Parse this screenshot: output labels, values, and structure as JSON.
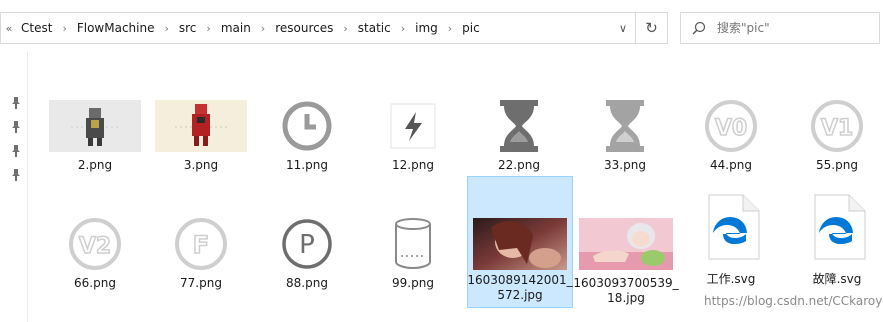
{
  "address_bar": {
    "prefix": "«",
    "crumbs": [
      "Ctest",
      "FlowMachine",
      "src",
      "main",
      "resources",
      "static",
      "img",
      "pic"
    ],
    "separator": "›",
    "dropdown": "∨"
  },
  "refresh_glyph": "↻",
  "search": {
    "placeholder": "搜索\"pic\""
  },
  "files": [
    {
      "name": "2.png",
      "icon": "robot-thumbnail-icon"
    },
    {
      "name": "3.png",
      "icon": "robot-red-thumbnail-icon"
    },
    {
      "name": "11.png",
      "icon": "clock-icon"
    },
    {
      "name": "12.png",
      "icon": "lightning-icon"
    },
    {
      "name": "22.png",
      "icon": "hourglass-dark-icon"
    },
    {
      "name": "33.png",
      "icon": "hourglass-gray-icon"
    },
    {
      "name": "44.png",
      "icon": "v0-badge-icon",
      "text": "V0"
    },
    {
      "name": "55.png",
      "icon": "v1-badge-icon",
      "text": "V1"
    },
    {
      "name": "66.png",
      "icon": "v2-badge-icon",
      "text": "V2"
    },
    {
      "name": "77.png",
      "icon": "f-badge-icon",
      "text": "F"
    },
    {
      "name": "88.png",
      "icon": "p-badge-icon",
      "text": "P"
    },
    {
      "name": "99.png",
      "icon": "cylinder-icon"
    },
    {
      "name": "1603089142001_572.jpg",
      "icon": "anime-photo-thumbnail-icon",
      "selected": true
    },
    {
      "name": "1603093700539_18.jpg",
      "icon": "anime-photo-pink-thumbnail-icon"
    },
    {
      "name": "工作.svg",
      "icon": "edge-svg-file-icon"
    },
    {
      "name": "故障.svg",
      "icon": "edge-svg-file-icon"
    }
  ],
  "watermark": "https://blog.csdn.net/CCkaroy",
  "colors": {
    "selection": "#cce8ff",
    "edge_blue": "#0078d7",
    "icon_gray": "#9a9a9a"
  }
}
